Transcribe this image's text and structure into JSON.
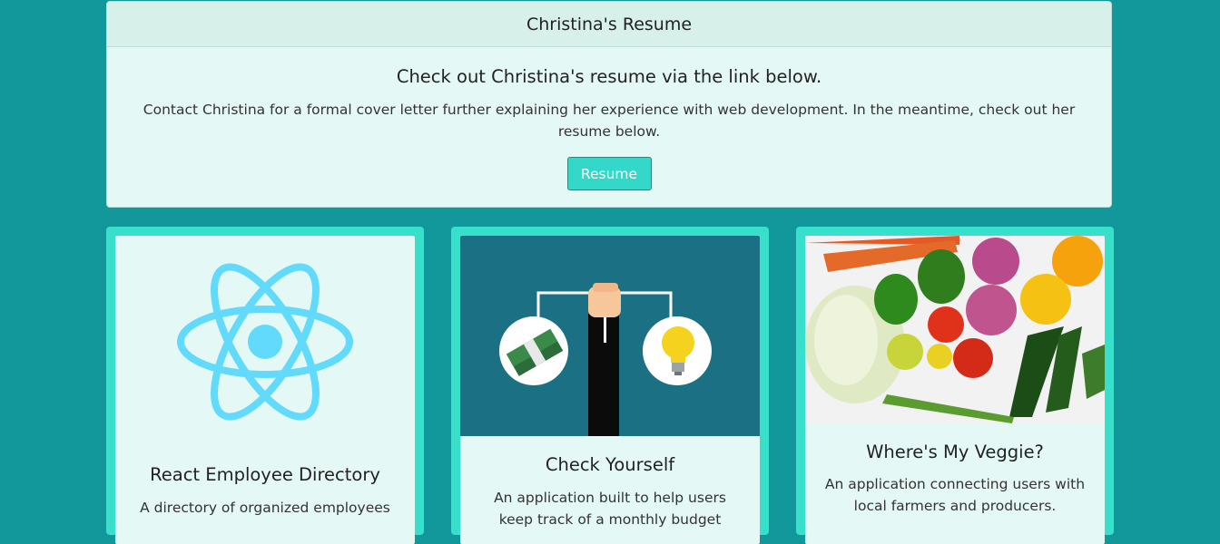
{
  "resume": {
    "header": "Christina's Resume",
    "title": "Check out Christina's resume via the link below.",
    "text": "Contact Christina for a formal cover letter further explaining her experience with web development. In the meantime, check out her resume below.",
    "button_label": "Resume"
  },
  "projects": [
    {
      "title": "React Employee Directory",
      "description": "A directory of organized employees",
      "icon": "react-logo-icon"
    },
    {
      "title": "Check Yourself",
      "description": "An application built to help users keep track of a monthly budget",
      "icon": "balance-money-idea-icon"
    },
    {
      "title": "Where's My Veggie?",
      "description": "An application connecting users with local farmers and producers.",
      "icon": "vegetables-image"
    }
  ],
  "colors": {
    "page_bg": "#12979b",
    "accent": "#38e0cc",
    "card_bg": "#e4f8f5",
    "react_blue": "#61dafb"
  }
}
